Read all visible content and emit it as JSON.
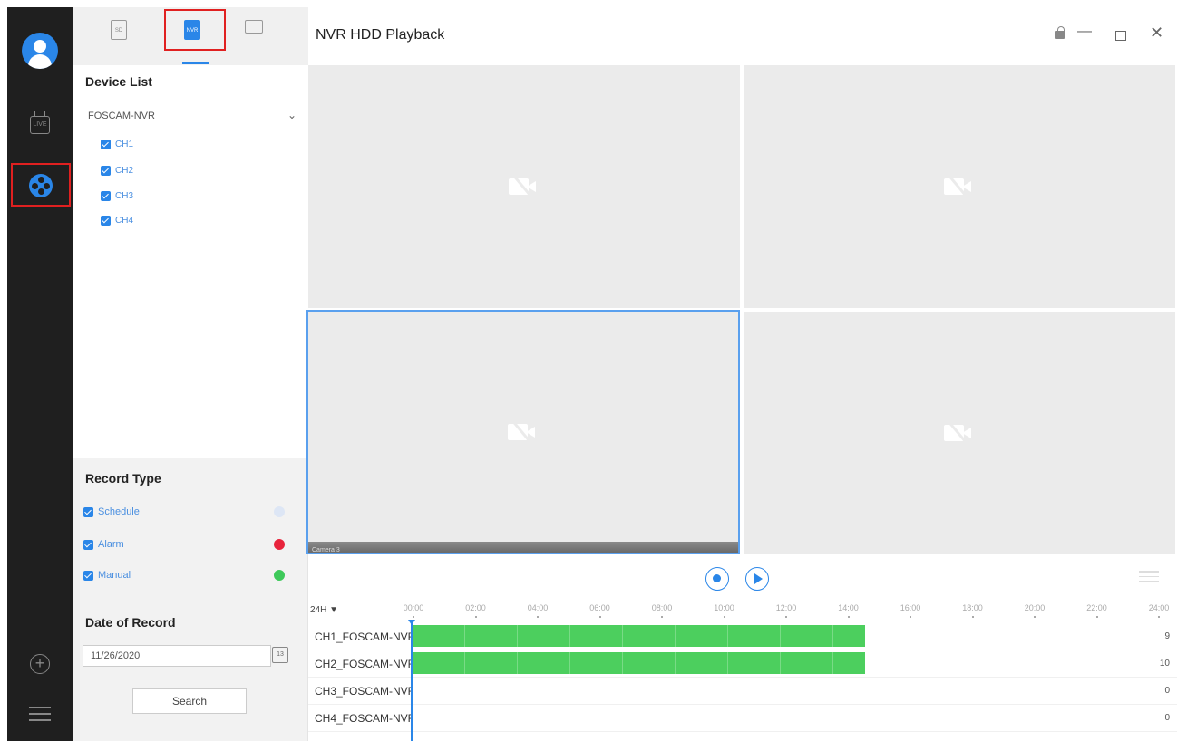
{
  "window": {
    "title": "NVR HDD Playback",
    "controls": [
      "lock-icon",
      "minimize-icon",
      "maximize-icon",
      "close-icon"
    ]
  },
  "rail": {
    "items": [
      "avatar",
      "live-icon",
      "playback-icon",
      "add-icon",
      "menu-icon"
    ],
    "live_label": "LIVE"
  },
  "panel": {
    "tabs": [
      {
        "name": "sd-card-tab",
        "label": "SD"
      },
      {
        "name": "nvr-tab",
        "label": "NVR"
      },
      {
        "name": "pc-tab",
        "label": ""
      }
    ],
    "device_list_title": "Device List",
    "device_name": "FOSCAM-NVR",
    "channels": [
      "CH1",
      "CH2",
      "CH3",
      "CH4"
    ],
    "record_type_title": "Record Type",
    "record_types": [
      {
        "label": "Schedule",
        "color": "#dde6f5"
      },
      {
        "label": "Alarm",
        "color": "#e8243c"
      },
      {
        "label": "Manual",
        "color": "#3ec95a"
      }
    ],
    "date_title": "Date of Record",
    "date_value": "11/26/2020",
    "calendar_day": "13",
    "search_label": "Search"
  },
  "player": {
    "camera_label": "Camera 3"
  },
  "timeline": {
    "range_label": "24H ▼",
    "ticks": [
      "00:00",
      "02:00",
      "04:00",
      "06:00",
      "08:00",
      "10:00",
      "12:00",
      "14:00",
      "16:00",
      "18:00",
      "20:00",
      "22:00",
      "24:00"
    ],
    "rows": [
      {
        "name": "CH1_FOSCAM-NVR",
        "count": "9",
        "record_end_hour": 14.6
      },
      {
        "name": "CH2_FOSCAM-NVR",
        "count": "10",
        "record_end_hour": 14.6
      },
      {
        "name": "CH3_FOSCAM-NVR",
        "count": "0",
        "record_end_hour": 0
      },
      {
        "name": "CH4_FOSCAM-NVR",
        "count": "0",
        "record_end_hour": 0
      }
    ]
  },
  "colors": {
    "accent": "#2a86e8",
    "highlight_frame": "#e02020",
    "record_bar": "#4ccf5e"
  }
}
